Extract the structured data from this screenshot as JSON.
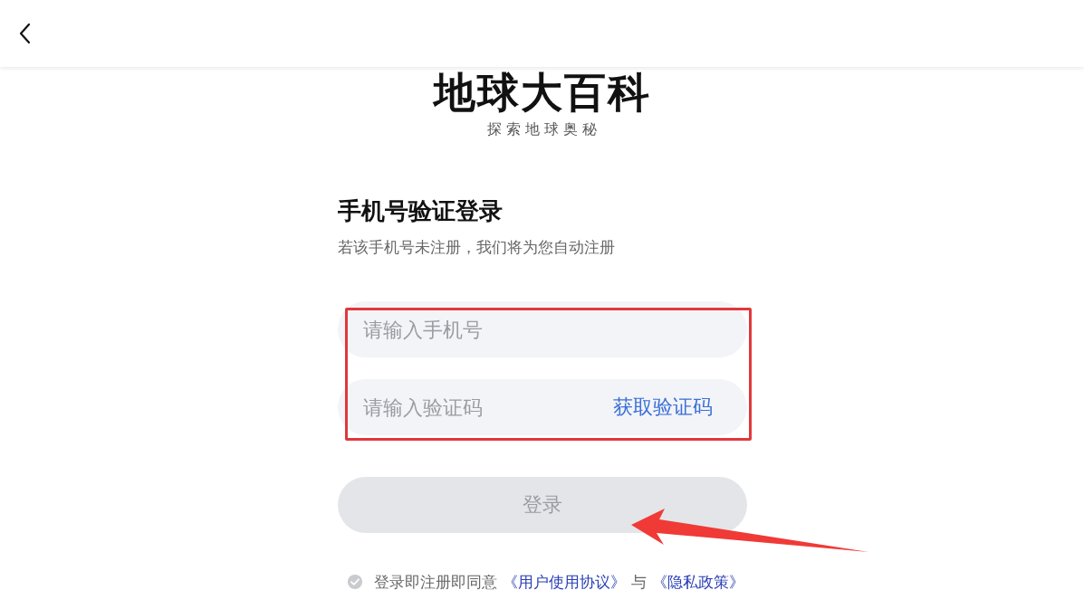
{
  "app": {
    "title": "地球大百科",
    "tagline": "探 索 地 球 奥 秘"
  },
  "login": {
    "heading": "手机号验证登录",
    "hint": "若该手机号未注册，我们将为您自动注册",
    "fields": [
      {
        "kind": "phone",
        "placeholder": "请输入手机号"
      },
      {
        "kind": "code",
        "placeholder": "请输入验证码",
        "action": "获取验证码"
      }
    ],
    "submit": {
      "label": "登录",
      "disabled": true
    },
    "agreement": {
      "checked": false,
      "parts": [
        {
          "kind": "text",
          "text": "登录即注册即同意"
        },
        {
          "kind": "link",
          "text": "《用户使用协议》"
        },
        {
          "kind": "text",
          "text": "与"
        },
        {
          "kind": "link",
          "text": "《隐私政策》"
        }
      ]
    }
  }
}
